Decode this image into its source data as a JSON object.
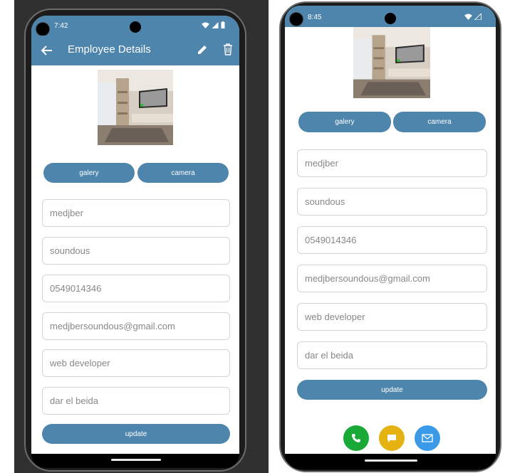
{
  "left_screen": {
    "status": {
      "time": "7:42"
    },
    "appbar": {
      "title": "Employee Details"
    },
    "buttons": {
      "gallery": "galery",
      "camera": "camera",
      "update": "update"
    },
    "fields": [
      "medjber",
      "soundous",
      "0549014346",
      "medjbersoundous@gmail.com",
      "web developer",
      "dar el beida"
    ]
  },
  "right_screen": {
    "status": {
      "time": "8:45"
    },
    "buttons": {
      "gallery": "galery",
      "camera": "camera",
      "update": "update"
    },
    "fields": [
      "medjber",
      "soundous",
      "0549014346",
      "medjbersoundous@gmail.com",
      "web developer",
      "dar el beida"
    ],
    "actions": [
      "phone-icon",
      "message-icon",
      "mail-icon"
    ]
  },
  "colors": {
    "primary": "#4e85ad",
    "call": "#19a936",
    "message": "#e5b20f",
    "mail": "#3a9ae8"
  }
}
